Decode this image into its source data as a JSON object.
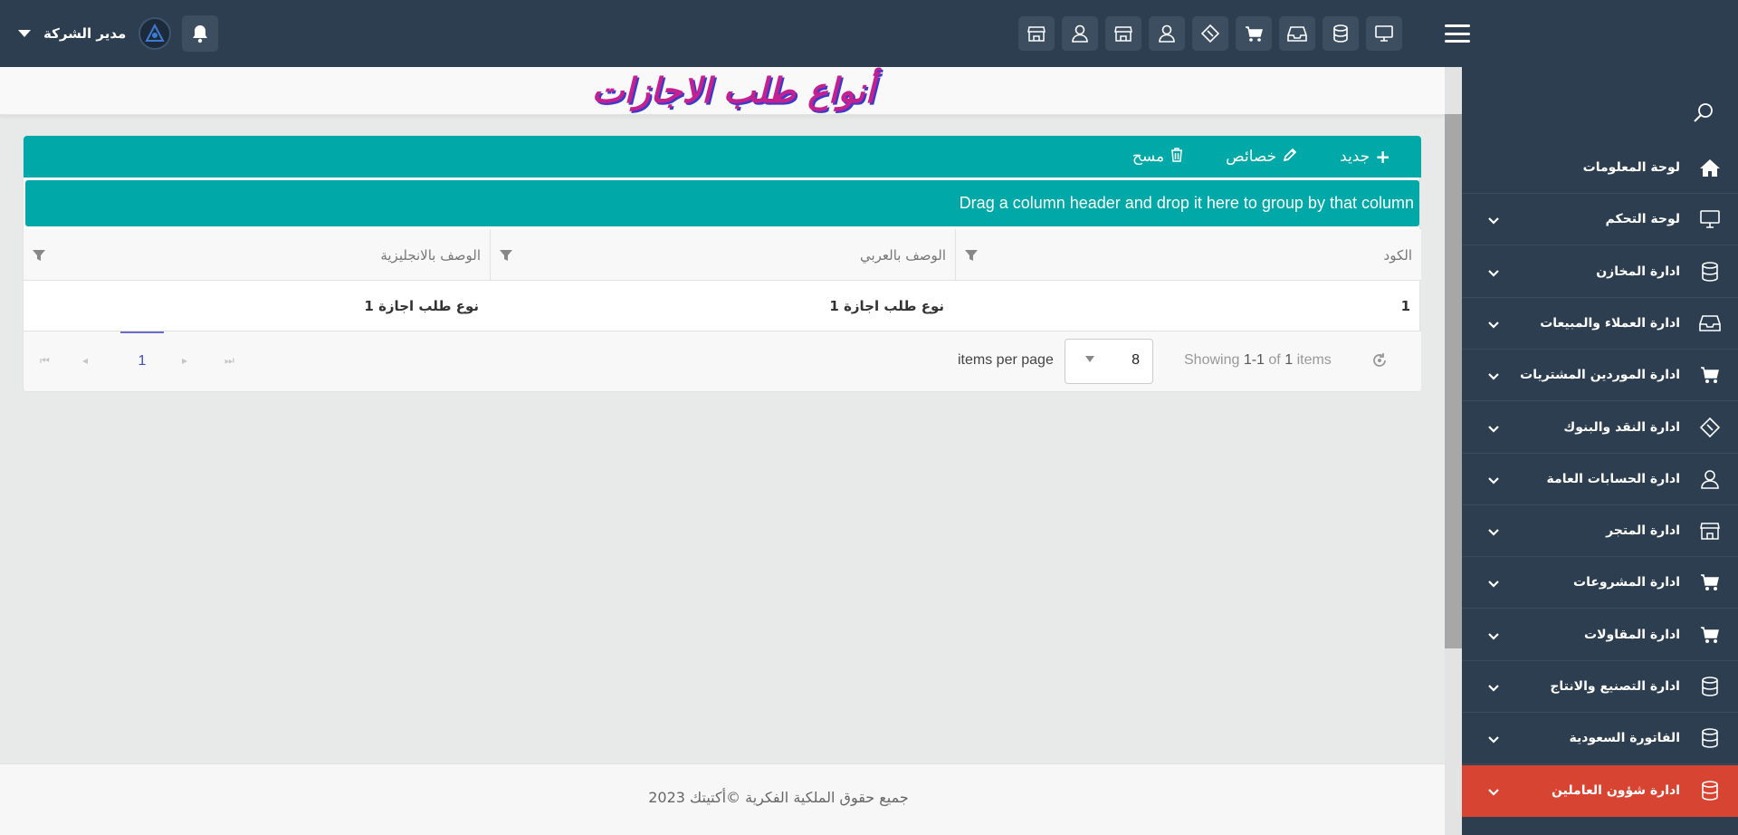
{
  "header": {
    "user_name": "مدير الشركة"
  },
  "page": {
    "title": "أنواع طلب الاجازات"
  },
  "toolbar": {
    "new_label": "جديد",
    "edit_label": "خصائص",
    "delete_label": "مسح"
  },
  "grid": {
    "group_hint": "Drag a column header and drop it here to group by that column",
    "columns": [
      "الكود",
      "الوصف بالعربي",
      "الوصف بالانجليزية"
    ],
    "rows": [
      [
        "1",
        "نوع طلب اجازة 1",
        "نوع طلب اجازة 1"
      ]
    ]
  },
  "pager": {
    "current_page": "1",
    "items_per_page": "8",
    "items_per_page_label": "items per page",
    "showing_prefix": "Showing",
    "showing_range": "1-1",
    "showing_of": "of",
    "showing_total": "1",
    "showing_suffix": "items"
  },
  "sidebar": {
    "items": [
      {
        "label": "لوحة المعلومات",
        "icon": "home-icon"
      },
      {
        "label": "لوحة التحكم",
        "icon": "monitor-icon"
      },
      {
        "label": "ادارة المخازن",
        "icon": "database-icon"
      },
      {
        "label": "ادارة العملاء والمبيعات",
        "icon": "inbox-icon"
      },
      {
        "label": "ادارة الموردين المشتريات",
        "icon": "cart-icon"
      },
      {
        "label": "ادارة النقد والبنوك",
        "icon": "ticket-icon"
      },
      {
        "label": "ادارة الحسابات العامة",
        "icon": "user-icon"
      },
      {
        "label": "ادارة المتجر",
        "icon": "store-icon"
      },
      {
        "label": "ادارة المشروعات",
        "icon": "cart-icon"
      },
      {
        "label": "ادارة المقاولات",
        "icon": "cart-icon"
      },
      {
        "label": "ادارة التصنيع والانتاج",
        "icon": "database-icon"
      },
      {
        "label": "الفاتورة السعودية",
        "icon": "database-icon"
      },
      {
        "label": "ادارة شؤون العاملين",
        "icon": "database-icon"
      }
    ]
  },
  "footer": {
    "text": "جميع حقوق الملكية الفكرية ©أكتيتك 2023"
  },
  "colors": {
    "topbar": "#2d3e50",
    "accent_teal": "#00a8a8",
    "active_item": "#d84432"
  }
}
